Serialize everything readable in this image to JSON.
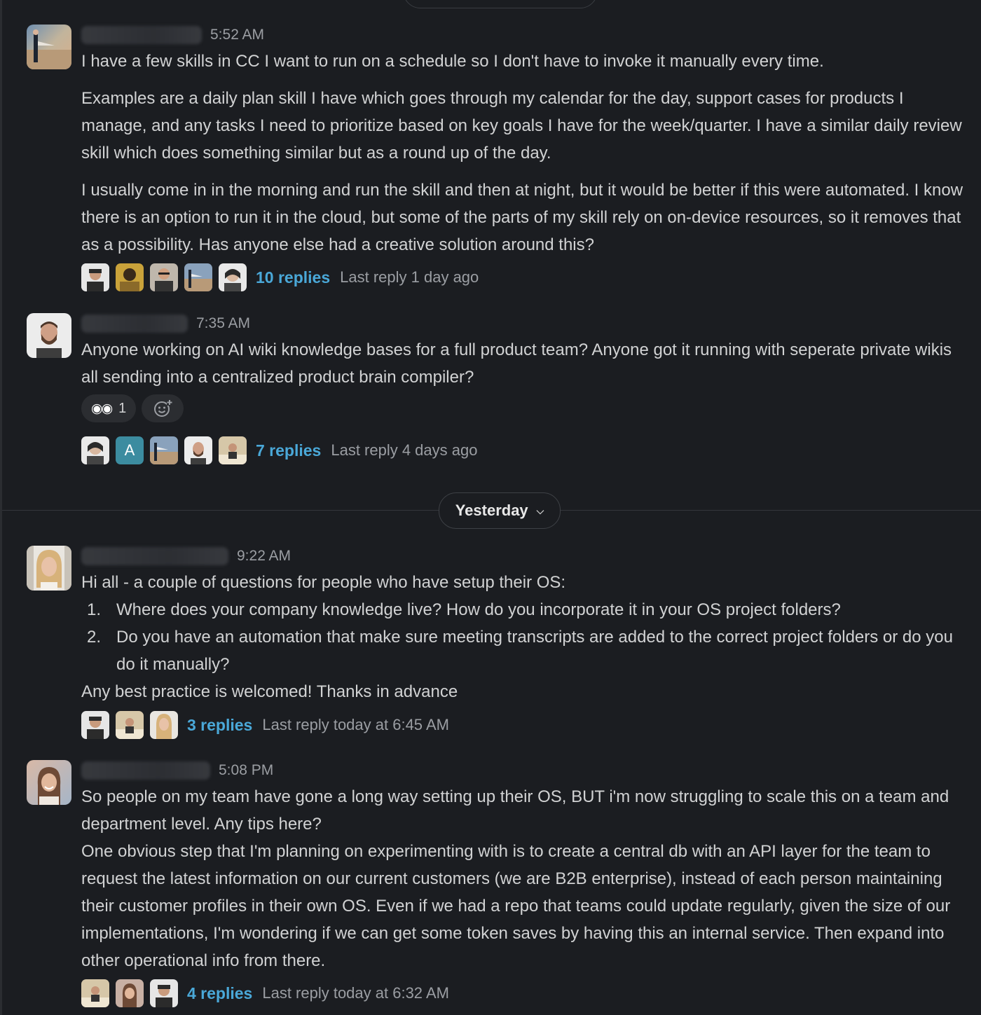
{
  "messages": [
    {
      "time": "5:52 AM",
      "paragraphs": [
        "I have a few skills in CC I want to run on a schedule so I don't have to invoke it manually every time.",
        "Examples are a daily plan skill I have which goes through my calendar for the day, support cases for products I manage, and any tasks I need to prioritize based on key goals I have for the week/quarter. I have a similar daily review skill which does something similar but as a round up of the day.",
        "I usually come in in the morning and run the skill and then at night, but it would be better if this were automated. I know there is an option to run it in the cloud, but some of the parts of my skill rely on on-device resources, so it removes that as a possibility. Has anyone else had a creative solution around this?"
      ],
      "replies": "10 replies",
      "last_reply": "Last reply 1 day ago"
    },
    {
      "time": "7:35 AM",
      "paragraphs": [
        "Anyone working on AI wiki knowledge bases for a full product team?  Anyone got it running with seperate private wikis all sending into a centralized product brain compiler?"
      ],
      "reaction": {
        "emoji": "eyes",
        "count": "1"
      },
      "replies": "7 replies",
      "last_reply": "Last reply 4 days ago",
      "participant_letter": "A"
    },
    {
      "time": "9:22 AM",
      "intro": "Hi all - a couple of questions for people who have setup their OS:",
      "list": [
        {
          "num": "1.",
          "text": "Where does your company knowledge live? How do you incorporate it in your OS project folders?"
        },
        {
          "num": "2.",
          "text": "Do you have an automation that make sure meeting transcripts are added to the correct project folders or do you do it manually?"
        }
      ],
      "outro": "Any best practice is welcomed! Thanks in advance",
      "replies": "3 replies",
      "last_reply": "Last reply today at 6:45 AM"
    },
    {
      "time": "5:08 PM",
      "line1": "So people on my team have gone a long way setting up their OS, BUT i'm now struggling to scale this on a team and department level. Any tips here?",
      "line2": "One obvious step that I'm planning on experimenting with is to create a central db with an API layer for the team to request the latest information on our current customers (we are B2B enterprise), instead of each person maintaining their customer profiles in their own OS. Even if we had a repo that teams could update regularly, given the size of our implementations, I'm wondering if we can get some token saves by having this an internal service. Then expand into other operational info from there.",
      "replies": "4 replies",
      "last_reply": "Last reply today at 6:32 AM"
    }
  ],
  "day_divider": {
    "label": "Yesterday",
    "icon": "chevron-down-icon"
  },
  "colors": {
    "background": "#1b1d21",
    "link": "#4aa8d8",
    "muted": "#9b9ea3",
    "text": "#d1d2d3"
  }
}
